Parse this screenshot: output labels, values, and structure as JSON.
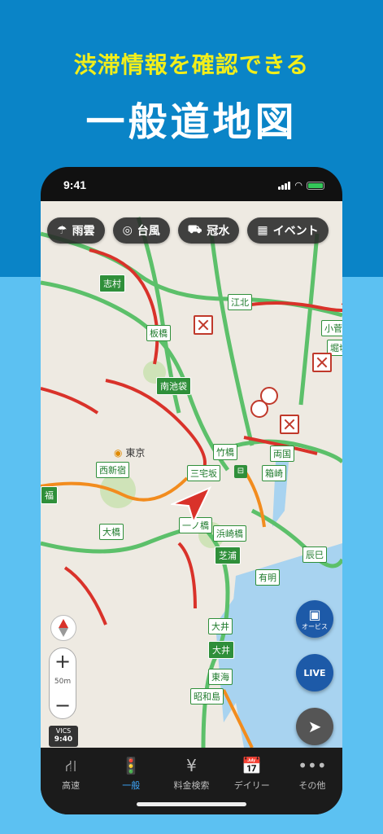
{
  "promo": {
    "subtitle": "渋滞情報を確認できる",
    "title": "一般道地図"
  },
  "status_bar": {
    "time": "9:41"
  },
  "chips": [
    {
      "icon": "rain-cloud-icon",
      "glyph": "☂",
      "label": "雨雲"
    },
    {
      "icon": "typhoon-icon",
      "glyph": "◎",
      "label": "台風"
    },
    {
      "icon": "flood-car-icon",
      "glyph": "⛟",
      "label": "冠水"
    },
    {
      "icon": "calendar-icon",
      "glyph": "▦",
      "label": "イベント"
    }
  ],
  "map_labels": {
    "shimura": "志村",
    "itabashi": "板橋",
    "ikebukuro": "南池袋",
    "koto": "江北",
    "kosuge": "小菅",
    "horikiri": "堀切",
    "tokyo": "東京",
    "takebashi": "竹橋",
    "ryogoku": "両国",
    "nishishinjuku": "西新宿",
    "sanzaka": "三宅坂",
    "hakozaki": "箱崎",
    "fuku": "福",
    "ohashi": "大橋",
    "ichinohashi": "一ノ橋",
    "hamazakibashi": "浜崎橋",
    "shibaura": "芝浦",
    "tatsumi": "辰巳",
    "ariake": "有明",
    "oi1": "大井",
    "oi2": "大井",
    "tokai": "東海",
    "showajima": "昭和島"
  },
  "fabs": {
    "orbis_label": "オービス",
    "live_label": "LIVE"
  },
  "zoom": {
    "plus": "+",
    "minus": "−",
    "scale": "50m"
  },
  "vics": {
    "brand": "VICS",
    "time": "9:40"
  },
  "tabs": [
    {
      "label": "高速",
      "glyph": "⛙",
      "icon": "highway-icon",
      "active": false
    },
    {
      "label": "一般",
      "glyph": "🚦",
      "icon": "traffic-light-icon",
      "active": true
    },
    {
      "label": "料金検索",
      "glyph": "¥",
      "icon": "yen-icon",
      "active": false
    },
    {
      "label": "デイリー",
      "glyph": "📅",
      "icon": "calendar-clock-icon",
      "active": false
    },
    {
      "label": "その他",
      "glyph": "•••",
      "icon": "more-icon",
      "active": false
    }
  ],
  "colors": {
    "header_blue": "#0a84c7",
    "lower_blue": "#5cc1f2",
    "subtitle_yellow": "#f2ee1a",
    "jam_red": "#d9322a",
    "slow_orange": "#f28c1e",
    "clear_green": "#5cc06a",
    "water": "#a8d3f0",
    "tab_active": "#3ea8ff"
  }
}
